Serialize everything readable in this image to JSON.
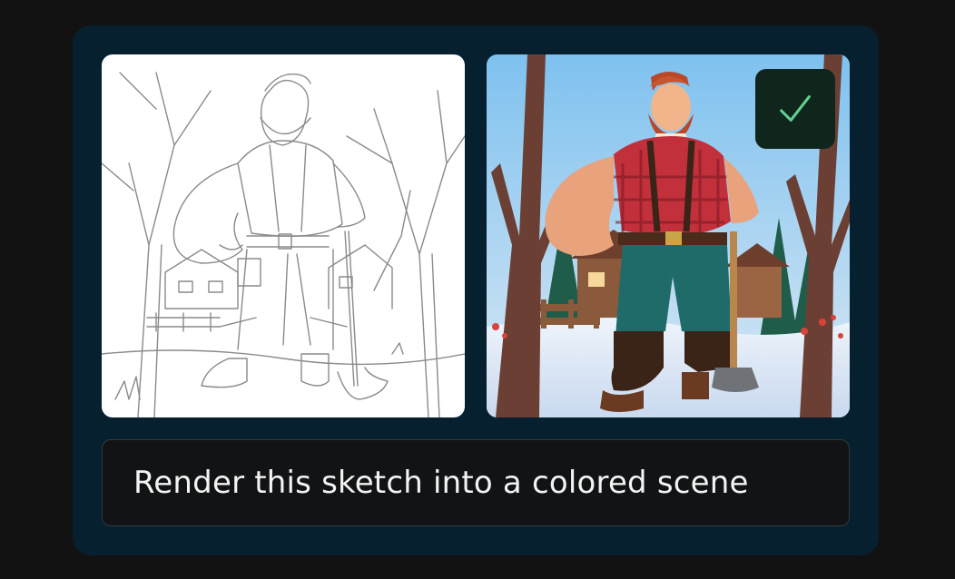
{
  "app": {
    "prompt": {
      "text": "Render this sketch into a colored scene"
    },
    "sketch_image": {
      "description": "black-and-white line sketch"
    },
    "rendered_image": {
      "description": "colored render"
    },
    "status": {
      "icon": "checkmark-icon",
      "accent_color": "#5fd08f"
    },
    "colors": {
      "background": "#121212",
      "card": "#06202f",
      "prompt_box": "#111315",
      "badge": "#10261d"
    }
  }
}
